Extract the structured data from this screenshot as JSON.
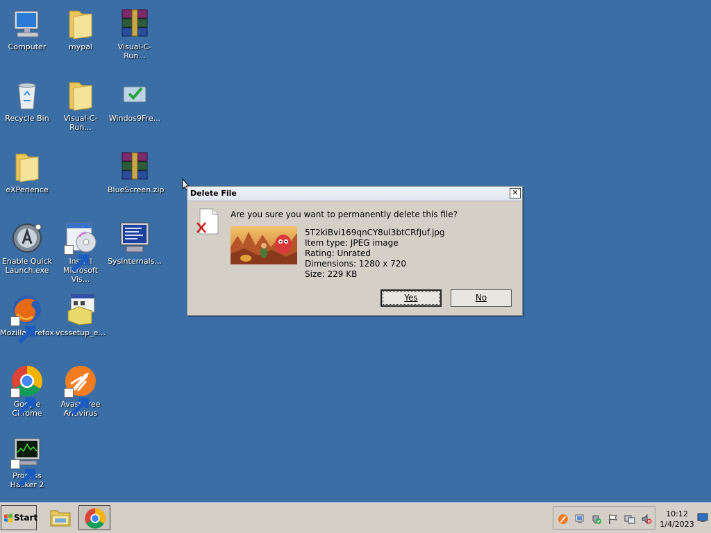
{
  "desktop_icons": [
    {
      "label": "Computer",
      "icon": "computer-icon"
    },
    {
      "label": "mypal",
      "icon": "folder-icon"
    },
    {
      "label": "Visual-C-Run...",
      "icon": "winrar-archive-icon"
    },
    {
      "label": "Recycle Bin",
      "icon": "recycle-bin-icon"
    },
    {
      "label": "Visual-C-Run...",
      "icon": "folder-icon"
    },
    {
      "label": "Windos9Fre...",
      "icon": "installer-icon"
    },
    {
      "label": "eXPerience",
      "icon": "folder-icon"
    },
    {
      "label": "BlueScreen.zip",
      "icon": "winrar-archive-icon"
    },
    {
      "label": "Enable Quick Launch.exe",
      "icon": "app-icon"
    },
    {
      "label": "Install Microsoft Vis...",
      "icon": "setup-cd-icon"
    },
    {
      "label": "SysInternals...",
      "icon": "monitor-app-icon"
    },
    {
      "label": "Mozilla Firefox",
      "icon": "firefox-icon"
    },
    {
      "label": "vcssetup_e...",
      "icon": "setup-icon"
    },
    {
      "label": "Google Chrome",
      "icon": "chrome-icon"
    },
    {
      "label": "Avast Free Antivirus",
      "icon": "avast-icon"
    },
    {
      "label": "Process Hacker 2",
      "icon": "process-hacker-icon"
    }
  ],
  "dialog": {
    "title": "Delete File",
    "close_label": "✕",
    "question": "Are you sure you want to permanently delete this file?",
    "file_name": "5T2kiBvi169qnCY8ul3btCRfJuf.jpg",
    "item_type": "Item type: JPEG image",
    "rating": "Rating: Unrated",
    "dimensions": "Dimensions: 1280 x 720",
    "size": "Size: 229 KB",
    "yes_label": "Yes",
    "no_label": "No"
  },
  "taskbar": {
    "start_label": "Start",
    "items": [
      {
        "icon": "file-explorer-icon"
      },
      {
        "icon": "chrome-icon"
      }
    ],
    "tray_icons": [
      "avast-tray-icon",
      "network-tray-icon",
      "security-tray-icon",
      "action-center-flag-icon",
      "display-tray-icon",
      "volume-muted-icon"
    ],
    "clock_time": "10:12",
    "clock_date": "1/4/2023"
  }
}
